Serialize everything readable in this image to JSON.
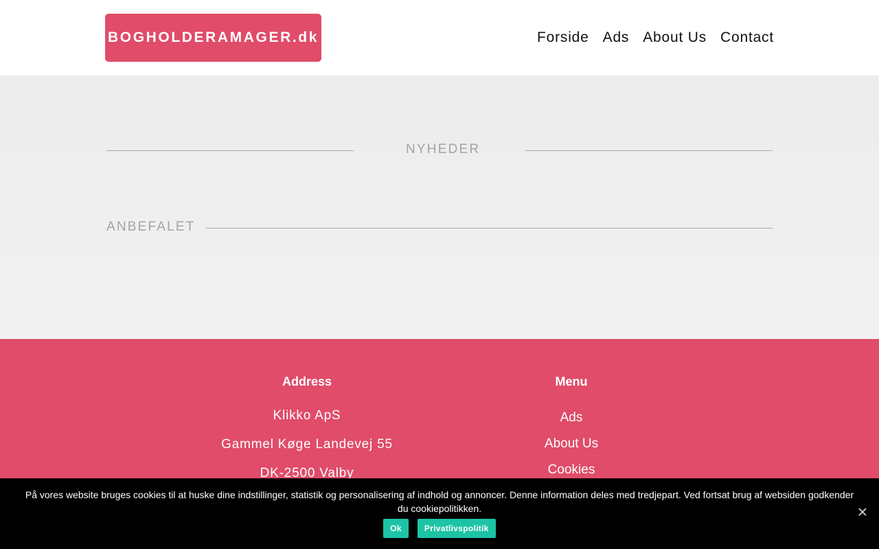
{
  "header": {
    "logo": "BOGHOLDERAMAGER.dk",
    "nav": [
      "Forside",
      "Ads",
      "About Us",
      "Contact"
    ]
  },
  "main": {
    "section_news": "NYHEDER",
    "section_recommended": "ANBEFALET"
  },
  "footer": {
    "address": {
      "heading": "Address",
      "lines": [
        "Klikko ApS",
        "Gammel Køge Landevej 55",
        "DK-2500 Valby"
      ]
    },
    "menu": {
      "heading": "Menu",
      "links": [
        "Ads",
        "About Us",
        "Cookies"
      ]
    }
  },
  "cookie_banner": {
    "text": "På vores website bruges cookies til at huske dine indstillinger, statistik og personalisering af indhold og annoncer. Denne information deles med tredjepart. Ved fortsat brug af websiden godkender du cookiepolitikken.",
    "ok_label": "Ok",
    "privacy_label": "Privatlivspolitik",
    "close_icon": "close-icon"
  },
  "colors": {
    "brand": "#e04c69",
    "cookie_button": "#1cc4a5",
    "header_bg": "#ffffff",
    "body_bg": "#efefef",
    "banner_bg": "#000000"
  }
}
